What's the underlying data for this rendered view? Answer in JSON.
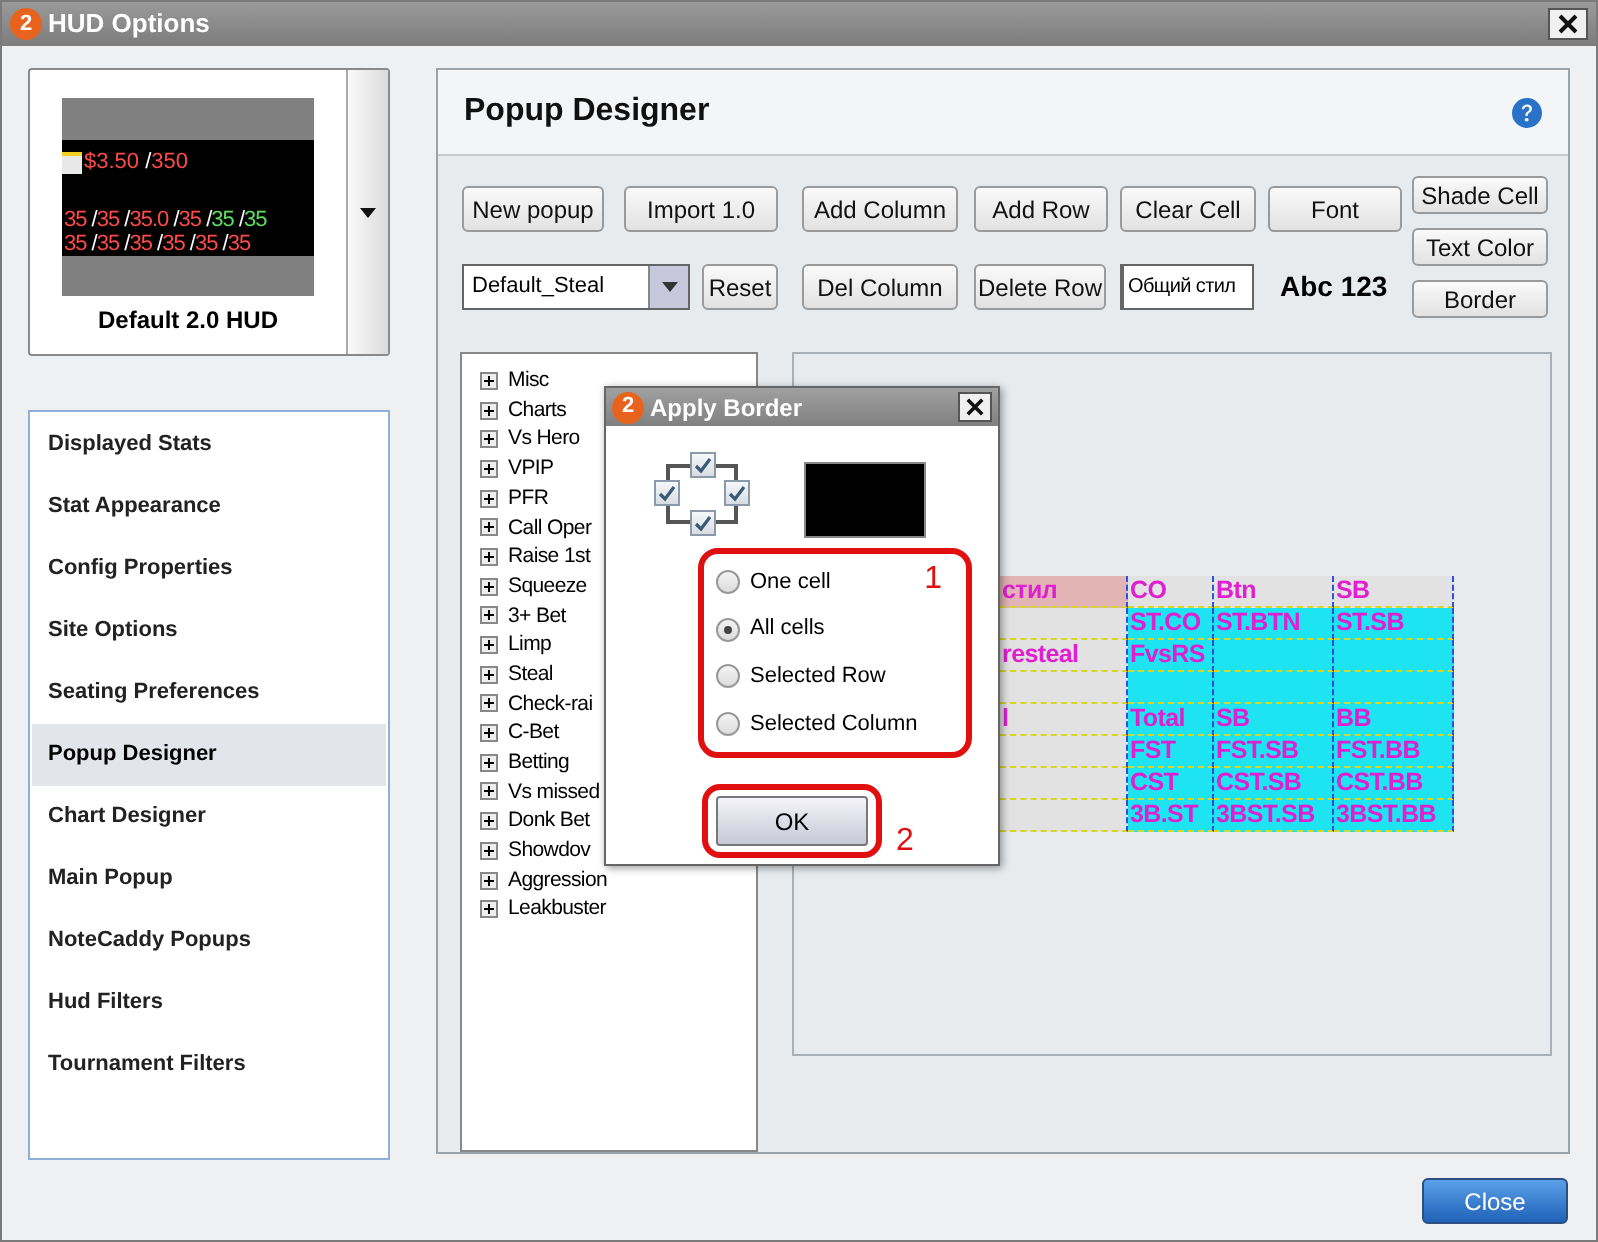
{
  "window": {
    "logo_text": "2",
    "title": "HUD Options"
  },
  "hud_preview": {
    "lines": [
      [
        {
          "text": "$3.50",
          "color": "#ff4a4a"
        },
        {
          "text": " /",
          "color": "#ffffff"
        },
        {
          "text": "350",
          "color": "#ff4a4a"
        }
      ],
      [
        {
          "text": "35",
          "color": "#ff4a4a"
        },
        {
          "text": " /",
          "color": "#ffffff"
        },
        {
          "text": "35",
          "color": "#ff4a4a"
        },
        {
          "text": " /",
          "color": "#ffffff"
        },
        {
          "text": "35.0",
          "color": "#ff4a4a"
        },
        {
          "text": " /",
          "color": "#ffffff"
        },
        {
          "text": "35",
          "color": "#ff4a4a"
        },
        {
          "text": " /",
          "color": "#ffffff"
        },
        {
          "text": "35",
          "color": "#5ee05e"
        },
        {
          "text": " /",
          "color": "#ffffff"
        },
        {
          "text": "35",
          "color": "#5ee05e"
        }
      ],
      [
        {
          "text": "35",
          "color": "#ff4a4a"
        },
        {
          "text": " /",
          "color": "#ffffff"
        },
        {
          "text": "35",
          "color": "#ff4a4a"
        },
        {
          "text": " /",
          "color": "#ffffff"
        },
        {
          "text": "35",
          "color": "#ff4a4a"
        },
        {
          "text": " /",
          "color": "#ffffff"
        },
        {
          "text": "35",
          "color": "#ff4a4a"
        },
        {
          "text": " /",
          "color": "#ffffff"
        },
        {
          "text": "35",
          "color": "#ff4a4a"
        },
        {
          "text": " /",
          "color": "#ffffff"
        },
        {
          "text": "35",
          "color": "#ff4a4a"
        }
      ]
    ],
    "caption": "Default 2.0 HUD"
  },
  "sidebar": {
    "items": [
      {
        "label": "Displayed Stats",
        "selected": false
      },
      {
        "label": "Stat Appearance",
        "selected": false
      },
      {
        "label": "Config Properties",
        "selected": false
      },
      {
        "label": "Site Options",
        "selected": false
      },
      {
        "label": "Seating Preferences",
        "selected": false
      },
      {
        "label": "Popup Designer",
        "selected": true
      },
      {
        "label": "Chart Designer",
        "selected": false
      },
      {
        "label": "Main Popup",
        "selected": false
      },
      {
        "label": "NoteCaddy Popups",
        "selected": false
      },
      {
        "label": "Hud Filters",
        "selected": false
      },
      {
        "label": "Tournament Filters",
        "selected": false
      }
    ]
  },
  "panel": {
    "title": "Popup Designer"
  },
  "toolbar": {
    "row1": [
      "New popup",
      "Import 1.0",
      "Add Column",
      "Add Row",
      "Clear Cell",
      "Font"
    ],
    "style_dropdown": {
      "value": "Default_Steal"
    },
    "reset": "Reset",
    "row2": [
      "Del Column",
      "Delete Row"
    ],
    "style_field": {
      "value": "Общий стил"
    },
    "font_preview": "Abc 123",
    "side_buttons": [
      "Shade Cell",
      "Text Color",
      "Border"
    ]
  },
  "tree": {
    "items": [
      {
        "label": "Misc",
        "expanded": false
      },
      {
        "label": "Charts",
        "expanded": false
      },
      {
        "label": "Vs Hero",
        "expanded": false
      },
      {
        "label": "VPIP",
        "expanded": false
      },
      {
        "label": "PFR",
        "expanded": false
      },
      {
        "label": "Call Oper",
        "expanded": false
      },
      {
        "label": "Raise 1st",
        "expanded": false
      },
      {
        "label": "Squeeze",
        "expanded": false
      },
      {
        "label": "3+ Bet",
        "expanded": false
      },
      {
        "label": "Limp",
        "expanded": false
      },
      {
        "label": "Steal",
        "expanded": false
      },
      {
        "label": "Check-rai",
        "expanded": false
      },
      {
        "label": "C-Bet",
        "expanded": false
      },
      {
        "label": "Betting",
        "expanded": false
      },
      {
        "label": "Vs missed",
        "expanded": false
      },
      {
        "label": "Donk Bet",
        "expanded": false
      },
      {
        "label": "Showdov",
        "expanded": false
      },
      {
        "label": "Aggression",
        "expanded": false
      },
      {
        "label": "Leakbuster",
        "expanded": false
      }
    ]
  },
  "grid": {
    "rows": [
      [
        {
          "text": "стил",
          "color": "#e2b4b4"
        },
        {
          "text": "CO",
          "color": "#e2e2e2"
        },
        {
          "text": "Btn",
          "color": "#e2e2e2"
        },
        {
          "text": "SB",
          "color": "#e2e2e2"
        }
      ],
      [
        {
          "color": "#e2e2e2"
        },
        {
          "text": "ST.CO",
          "color": "#1ee3f0"
        },
        {
          "text": "ST.BTN",
          "color": "#1ee3f0"
        },
        {
          "text": "ST.SB",
          "color": "#1ee3f0"
        }
      ],
      [
        {
          "text": "resteal",
          "color": "#e2e2e2"
        },
        {
          "text": "FvsRS",
          "color": "#1ee3f0"
        },
        {
          "color": "#1ee3f0"
        },
        {
          "color": "#1ee3f0"
        }
      ],
      [
        {
          "color": "#e2e2e2"
        },
        {
          "color": "#1ee3f0"
        },
        {
          "color": "#1ee3f0"
        },
        {
          "color": "#1ee3f0"
        }
      ],
      [
        {
          "text": "l",
          "color": "#e2e2e2"
        },
        {
          "text": "Total",
          "color": "#1ee3f0"
        },
        {
          "text": "SB",
          "color": "#1ee3f0"
        },
        {
          "text": "BB",
          "color": "#1ee3f0"
        }
      ],
      [
        {
          "color": "#e2e2e2"
        },
        {
          "text": "FST",
          "color": "#1ee3f0"
        },
        {
          "text": "FST.SB",
          "color": "#1ee3f0"
        },
        {
          "text": "FST.BB",
          "color": "#1ee3f0"
        }
      ],
      [
        {
          "color": "#e2e2e2"
        },
        {
          "text": "CST",
          "color": "#1ee3f0"
        },
        {
          "text": "CST.SB",
          "color": "#1ee3f0"
        },
        {
          "text": "CST.BB",
          "color": "#1ee3f0"
        }
      ],
      [
        {
          "color": "#e2e2e2"
        },
        {
          "text": "3B.ST",
          "color": "#1ee3f0"
        },
        {
          "text": "3BST.SB",
          "color": "#1ee3f0"
        },
        {
          "text": "3BST.BB",
          "color": "#1ee3f0"
        }
      ]
    ]
  },
  "dialog": {
    "logo_text": "2",
    "title": "Apply Border",
    "borders": [
      {
        "checked": true
      },
      {
        "checked": true
      },
      {
        "checked": true
      },
      {
        "checked": true
      }
    ],
    "color_swatch": {
      "color": "#000000"
    },
    "options": [
      {
        "label": "One cell",
        "selected": false
      },
      {
        "label": "All cells",
        "selected": true
      },
      {
        "label": "Selected Row",
        "selected": false
      },
      {
        "label": "Selected Column",
        "selected": false
      }
    ],
    "options_marker": "1",
    "ok": "OK",
    "ok_marker": "2"
  },
  "close_button": "Close"
}
